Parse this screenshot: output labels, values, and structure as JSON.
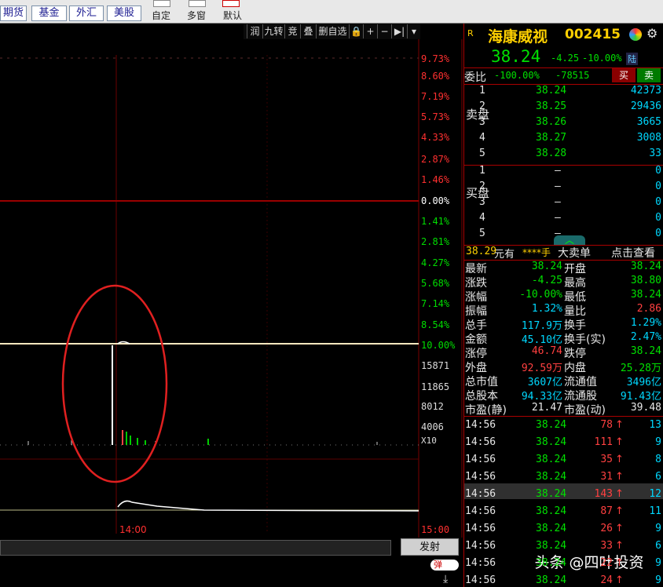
{
  "toolbar": {
    "tabs": [
      "期货",
      "基金",
      "外汇",
      "美股"
    ],
    "actions": [
      "自定",
      "多窗",
      "默认"
    ]
  },
  "chart_toolbar": {
    "items": [
      "润",
      "九转",
      "竞",
      "叠",
      "删自选",
      "🔒",
      "+",
      "−",
      "▶|"
    ]
  },
  "price_axis": [
    "9.73%",
    "8.60%",
    "7.19%",
    "5.73%",
    "4.33%",
    "2.87%",
    "1.46%",
    "0.00%",
    "1.41%",
    "2.81%",
    "4.27%",
    "5.68%",
    "7.14%",
    "8.54%",
    "10.00%"
  ],
  "volume_axis": [
    "15871",
    "11865",
    "8012",
    "4006",
    "X10"
  ],
  "time_label": "14:00",
  "end_time": "15:00",
  "fire_button": "发射",
  "popup_toggle": "弹",
  "stock": {
    "flag": "R",
    "name": "海康威视",
    "code": "002415",
    "price": "38.24",
    "change": "-4.25",
    "pct": "-10.00%",
    "market": "陆"
  },
  "weibi": {
    "label": "委比",
    "pct": "-100.00%",
    "diff": "-78515",
    "buy": "买",
    "sell": "卖"
  },
  "asks": [
    {
      "n": "5",
      "p": "38.28",
      "v": "33"
    },
    {
      "n": "4",
      "p": "38.27",
      "v": "3008"
    },
    {
      "n": "3",
      "p": "38.26",
      "v": "3665"
    },
    {
      "n": "2",
      "p": "38.25",
      "v": "29436"
    },
    {
      "n": "1",
      "p": "38.24",
      "v": "42373"
    }
  ],
  "bids": [
    {
      "n": "1",
      "p": "–",
      "v": "0"
    },
    {
      "n": "2",
      "p": "–",
      "v": "0"
    },
    {
      "n": "3",
      "p": "–",
      "v": "0"
    },
    {
      "n": "4",
      "p": "–",
      "v": "0"
    },
    {
      "n": "5",
      "p": "–",
      "v": "0"
    }
  ],
  "ask_side": "卖盘",
  "bid_side": "买盘",
  "big_order": {
    "price": "38.29",
    "unit": "元有",
    "qty": "****手",
    "big": "大卖单",
    "link": "点击查看"
  },
  "stats": [
    {
      "l1": "最新",
      "v1": "38.24",
      "c1": "grn",
      "l2": "开盘",
      "v2": "38.24",
      "c2": "grn"
    },
    {
      "l1": "涨跌",
      "v1": "-4.25",
      "c1": "grn",
      "l2": "最高",
      "v2": "38.80",
      "c2": "grn"
    },
    {
      "l1": "涨幅",
      "v1": "-10.00%",
      "c1": "grn",
      "l2": "最低",
      "v2": "38.24",
      "c2": "grn"
    },
    {
      "l1": "振幅",
      "v1": "1.32%",
      "c1": "cyn",
      "l2": "量比",
      "v2": "2.86",
      "c2": "red"
    },
    {
      "l1": "总手",
      "v1": "117.9万",
      "c1": "cyn",
      "l2": "换手",
      "v2": "1.29%",
      "c2": "cyn"
    },
    {
      "l1": "金额",
      "v1": "45.10亿",
      "c1": "cyn",
      "l2": "换手(实)",
      "v2": "2.47%",
      "c2": "cyn"
    },
    {
      "l1": "涨停",
      "v1": "46.74",
      "c1": "red",
      "l2": "跌停",
      "v2": "38.24",
      "c2": "grn"
    },
    {
      "l1": "外盘",
      "v1": "92.59万",
      "c1": "red",
      "l2": "内盘",
      "v2": "25.28万",
      "c2": "grn"
    },
    {
      "l1": "总市值",
      "v1": "3607亿",
      "c1": "cyn",
      "l2": "流通值",
      "v2": "3496亿",
      "c2": "cyn"
    },
    {
      "l1": "总股本",
      "v1": "94.33亿",
      "c1": "cyn",
      "l2": "流通股",
      "v2": "91.43亿",
      "c2": "cyn"
    },
    {
      "l1": "市盈(静)",
      "v1": "21.47",
      "c1": "wht",
      "l2": "市盈(动)",
      "v2": "39.48",
      "c2": "wht"
    }
  ],
  "ticks": [
    {
      "t": "14:56",
      "p": "38.24",
      "v": "78",
      "n": "13"
    },
    {
      "t": "14:56",
      "p": "38.24",
      "v": "111",
      "n": "9"
    },
    {
      "t": "14:56",
      "p": "38.24",
      "v": "35",
      "n": "8"
    },
    {
      "t": "14:56",
      "p": "38.24",
      "v": "31",
      "n": "6"
    },
    {
      "t": "14:56",
      "p": "38.24",
      "v": "143",
      "n": "12"
    },
    {
      "t": "14:56",
      "p": "38.24",
      "v": "87",
      "n": "11"
    },
    {
      "t": "14:56",
      "p": "38.24",
      "v": "26",
      "n": "9"
    },
    {
      "t": "14:56",
      "p": "38.24",
      "v": "33",
      "n": "6"
    },
    {
      "t": "14:56",
      "p": "38.24",
      "v": "22",
      "n": "9"
    },
    {
      "t": "14:56",
      "p": "38.24",
      "v": "24",
      "n": "9"
    }
  ],
  "watermark": "头条 @四叶投资"
}
